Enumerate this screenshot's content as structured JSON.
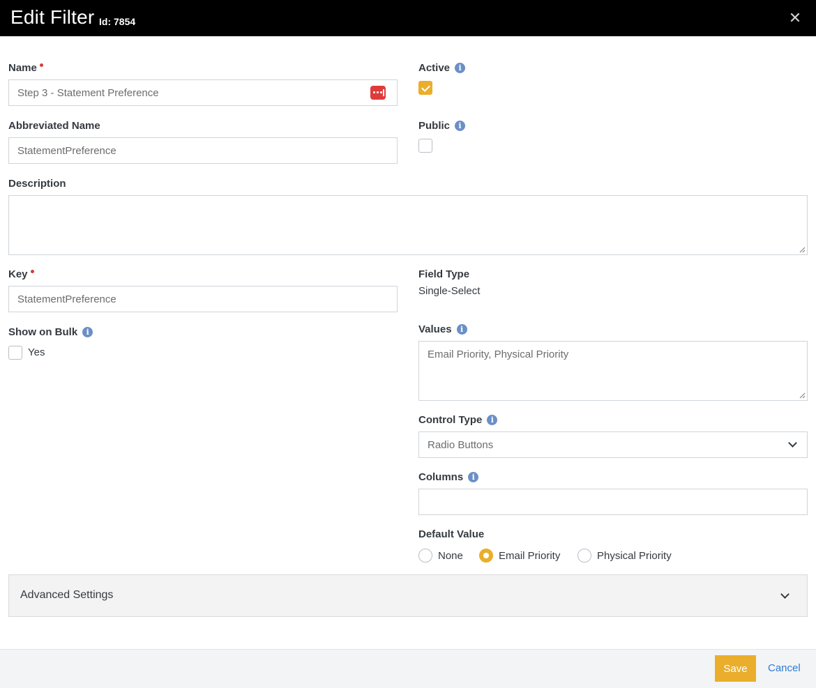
{
  "header": {
    "title": "Edit Filter",
    "subtitle": "Id: 7854",
    "close_glyph": "✕"
  },
  "form": {
    "name": {
      "label": "Name",
      "value": "Step 3 - Statement Preference"
    },
    "abbreviated_name": {
      "label": "Abbreviated Name",
      "value": "StatementPreference"
    },
    "active": {
      "label": "Active",
      "checked": true
    },
    "public": {
      "label": "Public",
      "checked": false
    },
    "description": {
      "label": "Description",
      "value": ""
    },
    "key": {
      "label": "Key",
      "value": "StatementPreference"
    },
    "field_type": {
      "label": "Field Type",
      "value": "Single-Select"
    },
    "show_on_bulk": {
      "label": "Show on Bulk",
      "option_label": "Yes",
      "checked": false
    },
    "values": {
      "label": "Values",
      "value": "Email Priority, Physical Priority"
    },
    "control_type": {
      "label": "Control Type",
      "value": "Radio Buttons"
    },
    "columns": {
      "label": "Columns",
      "value": ""
    },
    "default_value": {
      "label": "Default Value",
      "options": [
        "None",
        "Email Priority",
        "Physical Priority"
      ],
      "selected": "Email Priority"
    }
  },
  "advanced": {
    "label": "Advanced Settings"
  },
  "footer": {
    "save_label": "Save",
    "cancel_label": "Cancel"
  },
  "icons": {
    "info": "i",
    "password_manager": "lastpass-icon"
  },
  "colors": {
    "accent": "#eaae2c",
    "header_bg": "#000000",
    "link": "#2f7ad1",
    "required": "#d93a3a",
    "info": "#6b8fc7"
  }
}
